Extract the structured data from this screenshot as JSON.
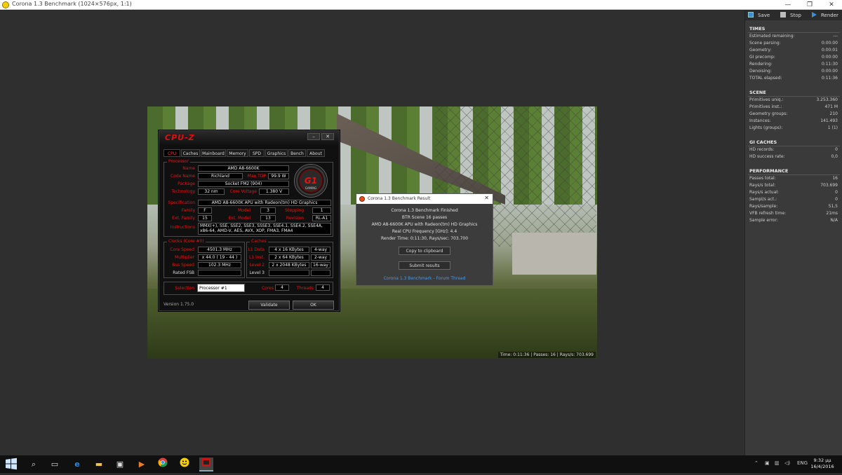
{
  "window": {
    "title": "Corona 1.3 Benchmark (1024×576px, 1:1)",
    "min": "—",
    "max": "❐",
    "close": "✕"
  },
  "scene_status": "Time: 0:11:36 | Passes: 16 | Rays/s: 703.699",
  "cpuz": {
    "logo": "CPU-Z",
    "tabs": [
      "CPU",
      "Caches",
      "Mainboard",
      "Memory",
      "SPD",
      "Graphics",
      "Bench",
      "About"
    ],
    "processor": {
      "section": "Processor",
      "name_label": "Name",
      "name": "AMD A8-6600K",
      "codename_label": "Code Name",
      "codename": "Richland",
      "maxtdp_label": "Max TDP",
      "maxtdp": "99.9 W",
      "package_label": "Package",
      "package": "Socket FM2 (904)",
      "technology_label": "Technology",
      "technology": "32 nm",
      "corevoltage_label": "Core Voltage",
      "corevoltage": "1.380 V",
      "spec_label": "Specification",
      "spec": "AMD A8-6600K APU with Radeon(tm) HD Graphics",
      "family_label": "Family",
      "family": "F",
      "model_label": "Model",
      "model": "3",
      "stepping_label": "Stepping",
      "stepping": "1",
      "extfamily_label": "Ext. Family",
      "extfamily": "15",
      "extmodel_label": "Ext. Model",
      "extmodel": "13",
      "revision_label": "Revision",
      "revision": "RL-A1",
      "instructions_label": "Instructions",
      "instructions_1": "MMX(+), SSE, SSE2, SSE3, SSSE3, SSE4.1, SSE4.2, SSE4A,",
      "instructions_2": "x86-64, AMD-V, AES, AVX, XOP, FMA3, FMA4",
      "badge_text": "G1",
      "badge_sub": "GAMING"
    },
    "clocks": {
      "section": "Clocks (Core #0)",
      "corespeed_label": "Core Speed",
      "corespeed": "4501.3 MHz",
      "multiplier_label": "Multiplier",
      "multiplier": "x 44.0 ( 19 - 44 )",
      "busspeed_label": "Bus Speed",
      "busspeed": "102.3 MHz",
      "ratedfsb_label": "Rated FSB",
      "ratedfsb": ""
    },
    "caches": {
      "section": "Caches",
      "l1d_label": "L1 Data",
      "l1d": "4 x 16 KBytes",
      "l1d_way": "4-way",
      "l1i_label": "L1 Inst.",
      "l1i": "2 x 64 KBytes",
      "l1i_way": "2-way",
      "l2_label": "Level 2",
      "l2": "2 x 2048 KBytes",
      "l2_way": "16-way",
      "l3_label": "Level 3",
      "l3": "",
      "l3_way": ""
    },
    "selection_label": "Selection",
    "selection": "Processor #1",
    "cores_label": "Cores",
    "cores": "4",
    "threads_label": "Threads",
    "threads": "4",
    "version": "Version 1.75.0",
    "validate": "Validate",
    "ok": "OK"
  },
  "dialog": {
    "title": "Corona 1.3 Benchmark Result",
    "close": "✕",
    "lines": [
      "Corona 1.3 Benchmark Finished",
      "BTR Scene 16 passes",
      "AMD A8-6600K APU with Radeon(tm) HD Graphics",
      "Real CPU Frequency [GHz]: 4.4",
      "Render Time: 0:11:30, Rays/sec: 703.700"
    ],
    "copy_button": "Copy to clipboard",
    "submit_button": "Submit results",
    "link": "Corona 1.3 Benchmark - Forum Thread"
  },
  "panel": {
    "toolbar": {
      "save": "Save",
      "stop": "Stop",
      "render": "Render"
    },
    "times": {
      "title": "TIMES",
      "rows": [
        [
          "Estimated remaining:",
          "---"
        ],
        [
          "Scene parsing:",
          "0:00:00"
        ],
        [
          "Geometry:",
          "0:00:01"
        ],
        [
          "GI precomp:",
          "0:00:00"
        ],
        [
          "Rendering:",
          "0:11:30"
        ],
        [
          "Denoising:",
          "0:00:00"
        ],
        [
          "TOTAL elapsed:",
          "0:11:36"
        ]
      ]
    },
    "scene": {
      "title": "SCENE",
      "rows": [
        [
          "Primitives uniq.:",
          "3.253.360"
        ],
        [
          "Primitives inst.:",
          "471 M"
        ],
        [
          "Geometry groups:",
          "210"
        ],
        [
          "Instances:",
          "141.493"
        ],
        [
          "Lights (groups):",
          "1 (1)"
        ]
      ]
    },
    "gi": {
      "title": "GI CACHES",
      "rows": [
        [
          "HD records:",
          "0"
        ],
        [
          "HD success rate:",
          "0,0"
        ]
      ]
    },
    "performance": {
      "title": "PERFORMANCE",
      "rows": [
        [
          "Passes total:",
          "16"
        ],
        [
          "Rays/s total:",
          "703.699"
        ],
        [
          "Rays/s actual:",
          "0"
        ],
        [
          "Sampl/s act.:",
          "0"
        ],
        [
          "Rays/sample:",
          "51,5"
        ],
        [
          "VFB refresh time:",
          "21ms"
        ],
        [
          "Sample error:",
          "N/A"
        ]
      ]
    }
  },
  "taskbar": {
    "icons": [
      "windows-start-icon",
      "search-icon",
      "task-view-icon",
      "edge-icon",
      "file-explorer-icon",
      "store-icon",
      "media-player-icon",
      "chrome-icon",
      "corona-smiley-icon",
      "cpuz-icon"
    ],
    "language": "ENG",
    "time": "9:32 μμ",
    "date": "16/4/2016"
  }
}
